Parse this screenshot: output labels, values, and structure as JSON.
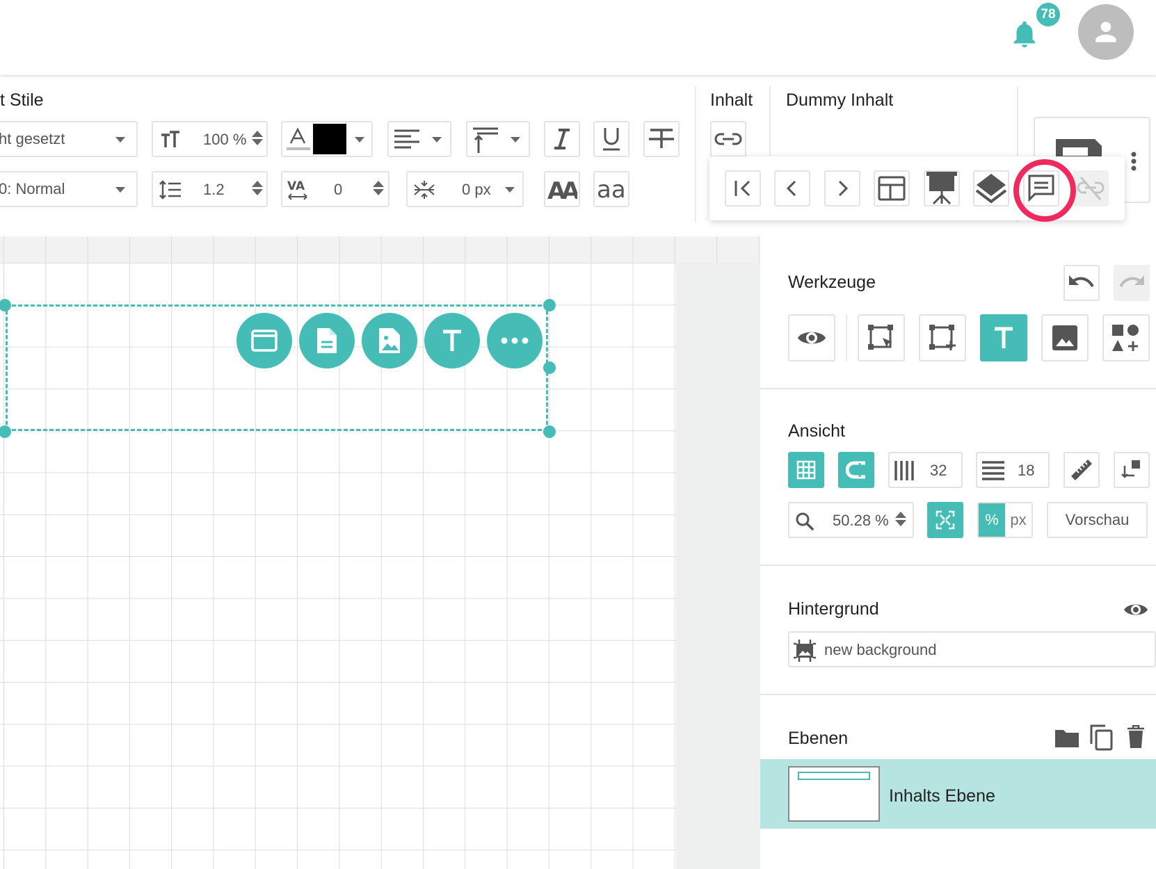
{
  "header": {
    "notifications_count": "78"
  },
  "toolbar": {
    "styles_title": "t Stile",
    "font_family_value": "ht gesetzt",
    "font_weight_value": "0: Normal",
    "font_size_value": "100 %",
    "line_height_value": "1.2",
    "letter_spacing_value": "0",
    "spacing_px_value": "0 px",
    "text_color": "#000000",
    "content_title": "Inhalt",
    "dummy_title": "Dummy Inhalt"
  },
  "tools": {
    "title": "Werkzeuge"
  },
  "view": {
    "title": "Ansicht",
    "columns": "32",
    "rows": "18",
    "zoom": "50.28 %",
    "unit_percent": "%",
    "unit_px": "px",
    "preview_label": "Vorschau"
  },
  "background": {
    "title": "Hintergrund",
    "value": "new background"
  },
  "layers": {
    "title": "Ebenen",
    "items": [
      {
        "label": "Inhalts Ebene"
      }
    ]
  },
  "colors": {
    "accent": "#45bdb6",
    "highlight": "#f0295f",
    "layer_bg": "#b5e4e1"
  }
}
